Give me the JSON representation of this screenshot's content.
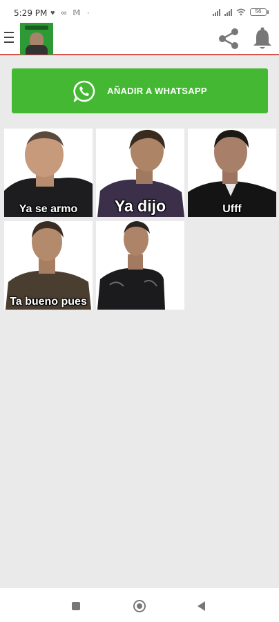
{
  "status_bar": {
    "time": "5:29 PM",
    "battery": "56"
  },
  "app_bar": {
    "menu_icon": "hamburger-menu-icon",
    "share_icon": "share-icon",
    "bell_icon": "bell-icon",
    "accent_color": "#d9534f"
  },
  "add_button": {
    "label": "AÑADIR A WHATSAPP",
    "icon": "whatsapp-icon",
    "color": "#44b833"
  },
  "stickers": [
    {
      "caption": "Ya se armo"
    },
    {
      "caption": "Ya dijo"
    },
    {
      "caption": "Ufff"
    },
    {
      "caption": "Ta bueno pues"
    },
    {
      "caption": ""
    }
  ],
  "nav_bar": {
    "recents_icon": "square-recents-icon",
    "home_icon": "circle-home-icon",
    "back_icon": "triangle-back-icon"
  }
}
